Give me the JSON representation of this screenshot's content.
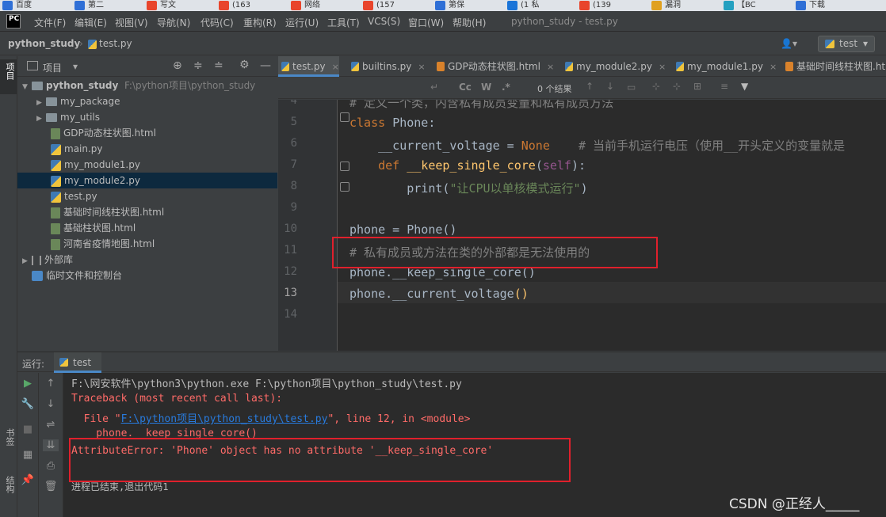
{
  "browser_tabs": [
    {
      "label": "百度",
      "color": "#2f6fd6"
    },
    {
      "label": "第二",
      "color": "#2f6fd6"
    },
    {
      "label": "写文",
      "color": "#e8452c"
    },
    {
      "label": "(163",
      "color": "#e8452c"
    },
    {
      "label": "网络",
      "color": "#e8452c"
    },
    {
      "label": "(157",
      "color": "#e8452c"
    },
    {
      "label": "第保",
      "color": "#2f6fd6"
    },
    {
      "label": "(1 私",
      "color": "#1a74d8"
    },
    {
      "label": "(139",
      "color": "#e8452c"
    },
    {
      "label": "漏洞",
      "color": "#e0a020"
    },
    {
      "label": "【BC",
      "color": "#24a0c0"
    },
    {
      "label": "下载",
      "color": "#2f6fd6"
    }
  ],
  "menu": {
    "logo": "PC",
    "items": [
      "文件(F)",
      "编辑(E)",
      "视图(V)",
      "导航(N)",
      "代码(C)",
      "重构(R)",
      "运行(U)",
      "工具(T)",
      "VCS(S)",
      "窗口(W)",
      "帮助(H)"
    ],
    "window_title": "python_study - test.py"
  },
  "nav": {
    "project": "python_study",
    "file": "test.py",
    "run_config": "test"
  },
  "left_strip": {
    "project_label": "项目",
    "bookmark_label": "书签",
    "structure_label": "结构"
  },
  "project": {
    "header": "项目",
    "root_name": "python_study",
    "root_path": "F:\\python项目\\python_study",
    "items": [
      {
        "label": "my_package",
        "type": "folder"
      },
      {
        "label": "my_utils",
        "type": "folder"
      },
      {
        "label": "GDP动态柱状图.html",
        "type": "html"
      },
      {
        "label": "main.py",
        "type": "py"
      },
      {
        "label": "my_module1.py",
        "type": "py"
      },
      {
        "label": "my_module2.py",
        "type": "py",
        "selected": true
      },
      {
        "label": "test.py",
        "type": "py"
      },
      {
        "label": "基础时间线柱状图.html",
        "type": "html"
      },
      {
        "label": "基础柱状图.html",
        "type": "html"
      },
      {
        "label": "河南省疫情地图.html",
        "type": "html"
      }
    ],
    "external_libs": "外部库",
    "scratches": "临时文件和控制台"
  },
  "editor_tabs": [
    "test.py",
    "builtins.py",
    "GDP动态柱状图.html",
    "my_module2.py",
    "my_module1.py",
    "基础时间线柱状图.htm"
  ],
  "find": {
    "results": "0 个结果",
    "cc": "Cc",
    "w": "W",
    "regex": ".*"
  },
  "code": {
    "line_numbers": [
      "4",
      "5",
      "6",
      "7",
      "8",
      "9",
      "10",
      "11",
      "12",
      "13",
      "14"
    ],
    "l4": "# 定义一个类，内含私有成员变量和私有成员方法",
    "l5_kw": "class ",
    "l5_name": "Phone:",
    "l6_var": "    __current_voltage = ",
    "l6_none": "None",
    "l6_cm": "    # 当前手机运行电压（使用__开头定义的变量就是",
    "l7_kw": "    def ",
    "l7_fn": "__keep_single_core",
    "l7_p1": "(",
    "l7_self": "self",
    "l7_p2": "):",
    "l8_pre": "        print(",
    "l8_str": "\"让CPU以单核模式运行\"",
    "l8_post": ")",
    "l10": "phone = Phone()",
    "l11": "# 私有成员或方法在类的外部都是无法使用的",
    "l12": "phone.__keep_single_core()",
    "l13_a": "phone.__current_voltage",
    "l13_b": "()"
  },
  "run": {
    "label": "运行:",
    "tab": "test",
    "cmd": "F:\\网安软件\\python3\\python.exe F:\\python项目\\python_study\\test.py",
    "tb1": "Traceback (most recent call last):",
    "tb2_a": "  File \"",
    "tb2_link": "F:\\python项目\\python_study\\test.py",
    "tb2_b": "\", line 12, in <module>",
    "tb3": "    phone.__keep_single_core()",
    "tb4": "AttributeError: 'Phone' object has no attribute '__keep_single_core'",
    "exit": "进程已结束,退出代码1"
  },
  "watermark": "CSDN @正经人_____"
}
